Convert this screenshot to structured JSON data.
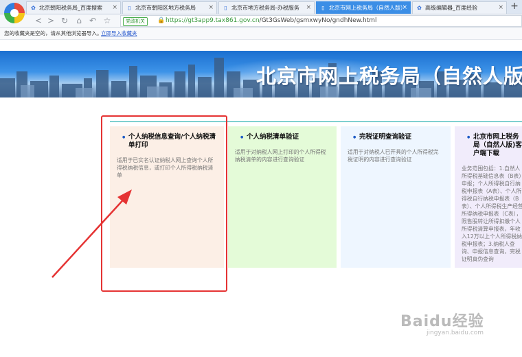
{
  "browser": {
    "tabs": [
      {
        "label": "北京朝阳税务局_百度搜索",
        "icon": "baidu-paw-icon",
        "active": false
      },
      {
        "label": "北京市朝阳区地方税务局",
        "icon": "page-icon",
        "active": false
      },
      {
        "label": "北京市地方税务局-办税服务",
        "icon": "page-icon",
        "active": false
      },
      {
        "label": "北京市网上税务局（自然人版）",
        "icon": "page-icon",
        "active": true
      },
      {
        "label": "高级编辑器_百度经验",
        "icon": "baidu-paw-icon",
        "active": false
      }
    ],
    "new_tab": "+",
    "address": {
      "badge": "党政机关",
      "url_host": "https://gt3app9.tax861.gov.cn",
      "url_path": "/Gt3GsWeb/gsmxwyNo/gndhNew.html"
    },
    "favorites_bar": {
      "message": "您的收藏夹是空的，请从其他浏览器导入。",
      "import_link": "立即导入收藏夹"
    }
  },
  "banner": {
    "title": "北京市网上税务局（自然人版"
  },
  "cards": [
    {
      "title": "个人纳税信息查询/个人纳税清单打印",
      "desc": "适用于已实名认证纳税人网上查询个人所得税纳税信息，或打印个人所得税纳税清单"
    },
    {
      "title": "个人纳税清单验证",
      "desc": "适用于对纳税人网上打印的个人所得税纳税清单的内容进行查询验证"
    },
    {
      "title": "完税证明查询验证",
      "desc": "适用于对纳税人已开具的个人所得税完税证明的内容进行查询验证"
    },
    {
      "title": "北京市网上税务局（自然人版)客户端下载",
      "desc": "业务范围包括：1.自然人所得税基础信息表（B表）申报；个人所得税自行纳税申报表（A表）、个人所得税自行纳税申报表（B表）、个人所得税生产经营所得纳税申报表（C表），限售股转让所得扣缴个人所得税清算申报表，年收入12万以上个人所得税纳税申报表；3.纳税人查询、申报信息查询，完税证明真伪查询"
    }
  ],
  "watermark": {
    "brand": "Baidu经验",
    "site": "jingyan.baidu.com"
  },
  "colors": {
    "active_tab": "#3b8ee6",
    "highlight_box": "#e53333",
    "url_green": "#3a9a3e"
  }
}
